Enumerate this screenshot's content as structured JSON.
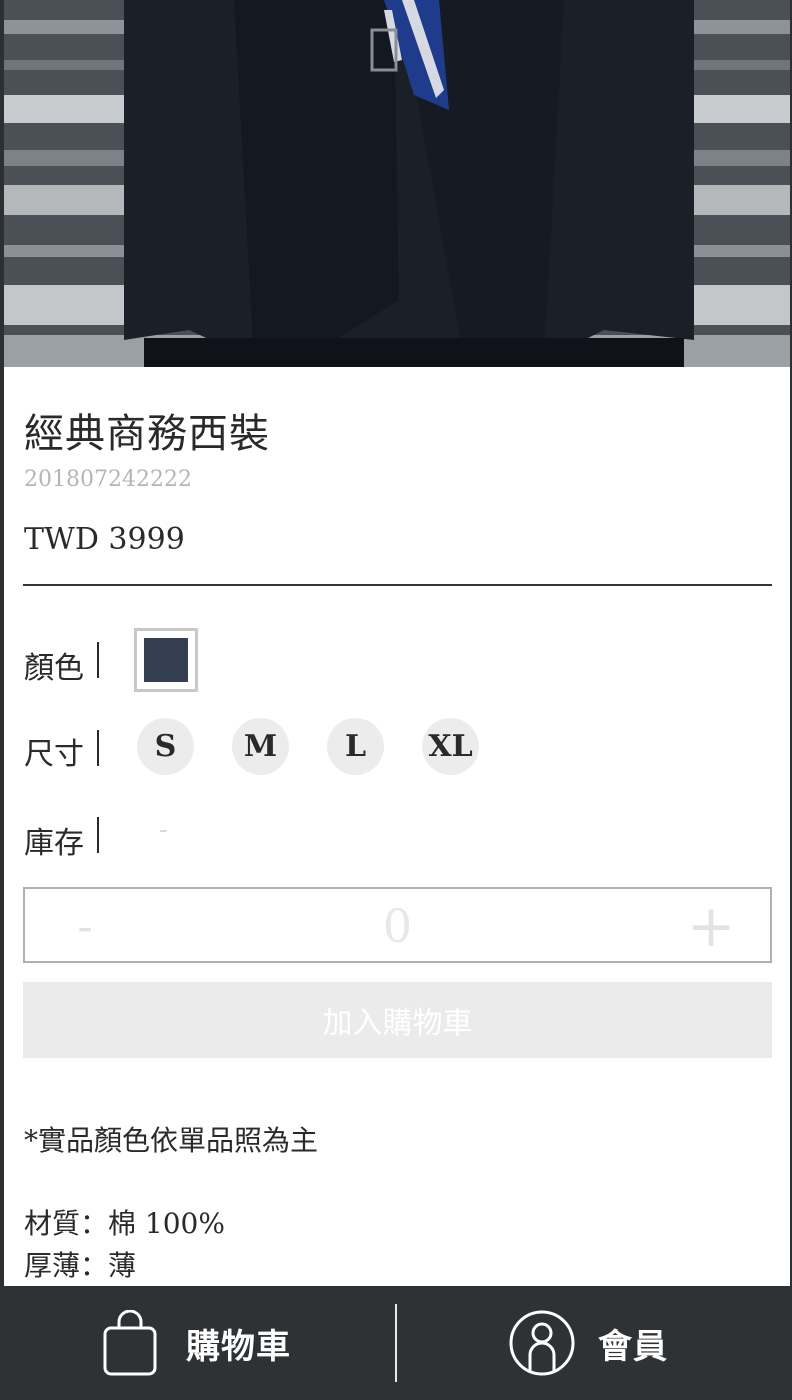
{
  "product": {
    "name": "經典商務西裝",
    "sku": "201807242222",
    "price": "TWD 3999"
  },
  "options": {
    "color_label": "顏色",
    "selected_color": "#344051",
    "size_label": "尺寸",
    "sizes": [
      "S",
      "M",
      "L",
      "XL"
    ],
    "stock_label": "庫存",
    "stock_value": "-"
  },
  "quantity": {
    "minus": "-",
    "value": "0",
    "plus": "+"
  },
  "add_to_cart": "加入購物車",
  "details": {
    "note": "*實品顏色依單品照為主",
    "material": "材質：棉 100%",
    "thickness": "厚薄：薄"
  },
  "tabbar": {
    "cart_label": "購物車",
    "cart_icon": "shopping-bag-icon",
    "member_label": "會員",
    "member_icon": "user-icon"
  }
}
